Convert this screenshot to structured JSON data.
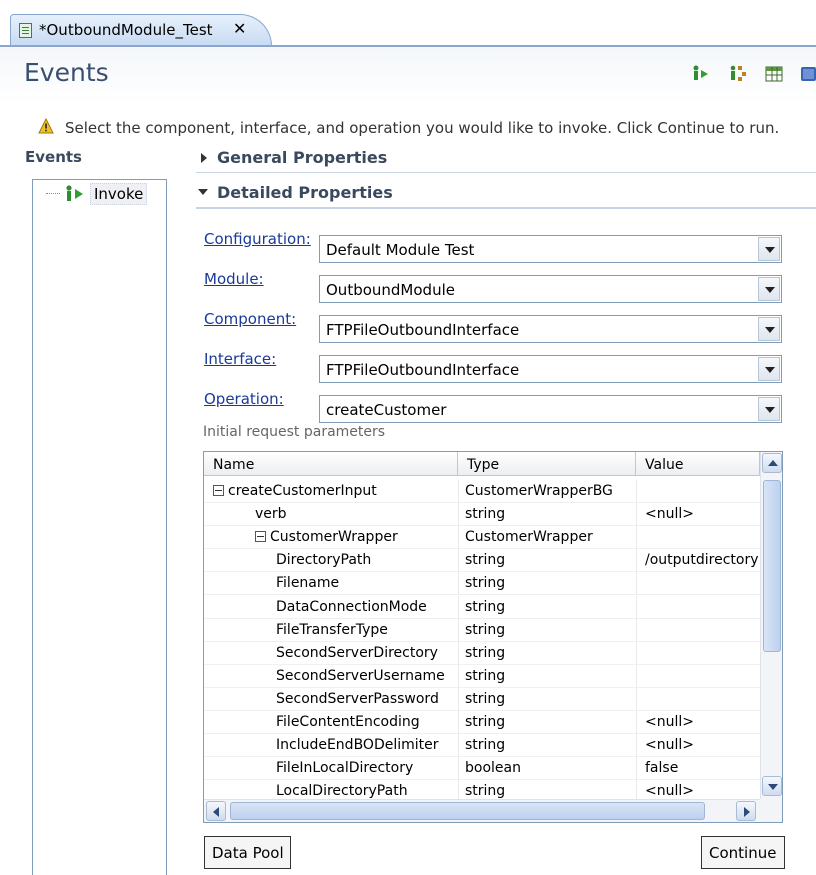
{
  "editor_tab": {
    "title": "*OutboundModule_Test",
    "close_glyph": "✕"
  },
  "header": {
    "title": "Events",
    "toolbar": [
      "invoke-icon",
      "attach-icon",
      "table-icon",
      "minimize-icon"
    ]
  },
  "instruction": "Select the component, interface, and operation you would like to invoke. Click Continue to run.",
  "events_pane": {
    "label": "Events",
    "items": [
      {
        "label": "Invoke"
      }
    ]
  },
  "sections": {
    "general": "General Properties",
    "detailed": "Detailed Properties"
  },
  "form": {
    "configuration": {
      "label": "Configuration:",
      "value": "Default Module Test"
    },
    "module": {
      "label": "Module:",
      "value": "OutboundModule"
    },
    "component": {
      "label": "Component:",
      "value": "FTPFileOutboundInterface"
    },
    "interface": {
      "label": "Interface:",
      "value": "FTPFileOutboundInterface"
    },
    "operation": {
      "label": "Operation:",
      "value": "createCustomer"
    }
  },
  "params": {
    "label": "Initial request parameters",
    "columns": [
      "Name",
      "Type",
      "Value"
    ],
    "rows": [
      {
        "name": "createCustomerInput",
        "type": "CustomerWrapperBG",
        "value": "",
        "level": 0,
        "expandable": true
      },
      {
        "name": "verb",
        "type": "string",
        "value": "<null>",
        "level": 1,
        "expandable": false
      },
      {
        "name": "CustomerWrapper",
        "type": "CustomerWrapper",
        "value": "",
        "level": 1,
        "expandable": true
      },
      {
        "name": "DirectoryPath",
        "type": "string",
        "value": "/outputdirectory",
        "level": 2,
        "expandable": false
      },
      {
        "name": "Filename",
        "type": "string",
        "value": "",
        "level": 2,
        "expandable": false
      },
      {
        "name": "DataConnectionMode",
        "type": "string",
        "value": "",
        "level": 2,
        "expandable": false
      },
      {
        "name": "FileTransferType",
        "type": "string",
        "value": "",
        "level": 2,
        "expandable": false
      },
      {
        "name": "SecondServerDirectory",
        "type": "string",
        "value": "",
        "level": 2,
        "expandable": false
      },
      {
        "name": "SecondServerUsername",
        "type": "string",
        "value": "",
        "level": 2,
        "expandable": false
      },
      {
        "name": "SecondServerPassword",
        "type": "string",
        "value": "",
        "level": 2,
        "expandable": false
      },
      {
        "name": "FileContentEncoding",
        "type": "string",
        "value": "<null>",
        "level": 2,
        "expandable": false
      },
      {
        "name": "IncludeEndBODelimiter",
        "type": "string",
        "value": "<null>",
        "level": 2,
        "expandable": false
      },
      {
        "name": "FileInLocalDirectory",
        "type": "boolean",
        "value": "false",
        "level": 2,
        "expandable": false
      },
      {
        "name": "LocalDirectoryPath",
        "type": "string",
        "value": "<null>",
        "level": 2,
        "expandable": false
      }
    ]
  },
  "buttons": {
    "data_pool": "Data Pool",
    "continue": "Continue"
  },
  "colors": {
    "link": "#1a3a9a",
    "title": "#3a4f6e",
    "tab": "#c8dbf3",
    "warning": "#f0c020"
  }
}
